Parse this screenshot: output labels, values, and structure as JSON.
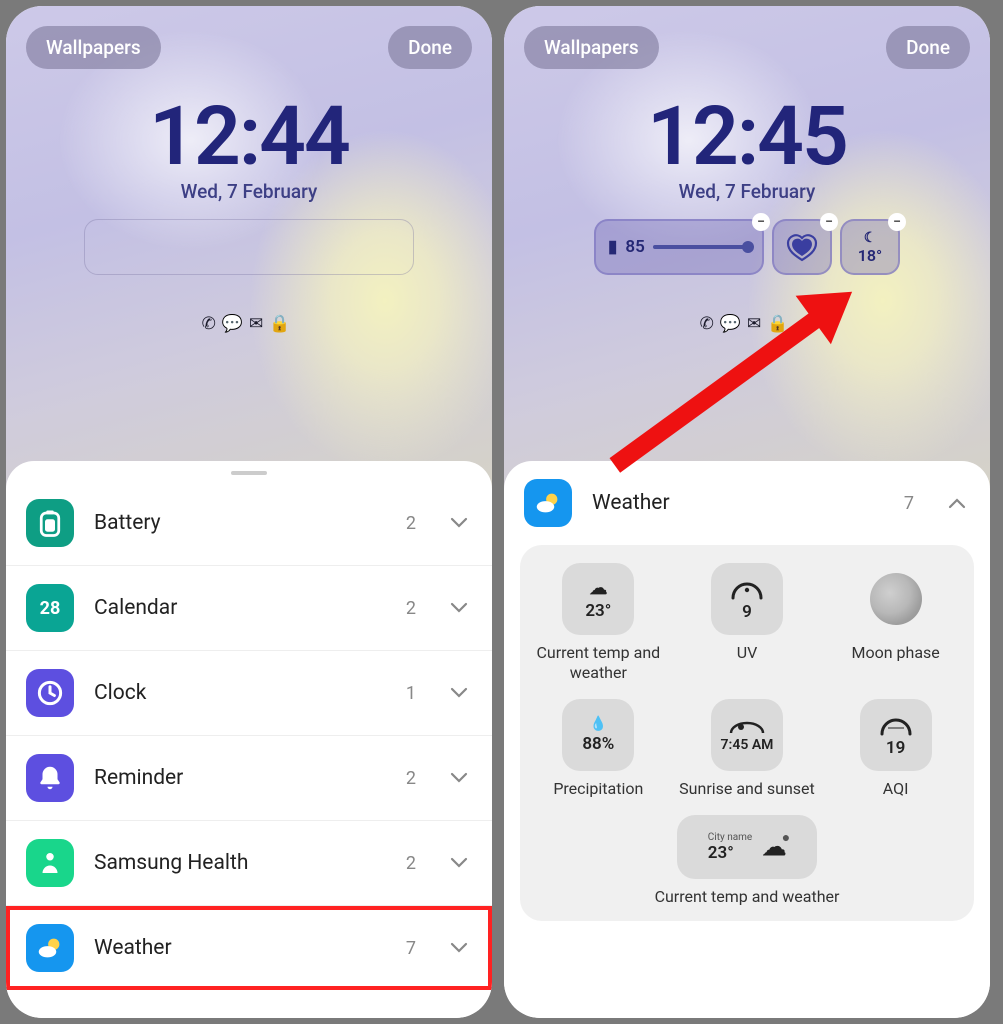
{
  "left": {
    "wallpapers_label": "Wallpapers",
    "done_label": "Done",
    "time": "12:44",
    "date": "Wed, 7 February",
    "apps": [
      {
        "id": "battery",
        "label": "Battery",
        "count": "2"
      },
      {
        "id": "calendar",
        "label": "Calendar",
        "count": "2",
        "day": "28"
      },
      {
        "id": "clock",
        "label": "Clock",
        "count": "1"
      },
      {
        "id": "reminder",
        "label": "Reminder",
        "count": "2"
      },
      {
        "id": "samsung-health",
        "label": "Samsung Health",
        "count": "2"
      },
      {
        "id": "weather",
        "label": "Weather",
        "count": "7"
      }
    ]
  },
  "right": {
    "wallpapers_label": "Wallpapers",
    "done_label": "Done",
    "time": "12:45",
    "date": "Wed, 7 February",
    "battery_widget_value": "85",
    "temp_widget_value": "18°",
    "weather_header": "Weather",
    "weather_count": "7",
    "widgets": {
      "temp": {
        "value": "23°",
        "label": "Current temp and weather"
      },
      "uv": {
        "value": "9",
        "label": "UV"
      },
      "moon": {
        "label": "Moon phase"
      },
      "precip": {
        "value": "88%",
        "label": "Precipitation"
      },
      "sun": {
        "value": "7:45 AM",
        "label": "Sunrise and sunset"
      },
      "aqi": {
        "value": "19",
        "label": "AQI"
      },
      "city": {
        "city": "City name",
        "value": "23°",
        "label": "Current temp and weather"
      }
    }
  }
}
